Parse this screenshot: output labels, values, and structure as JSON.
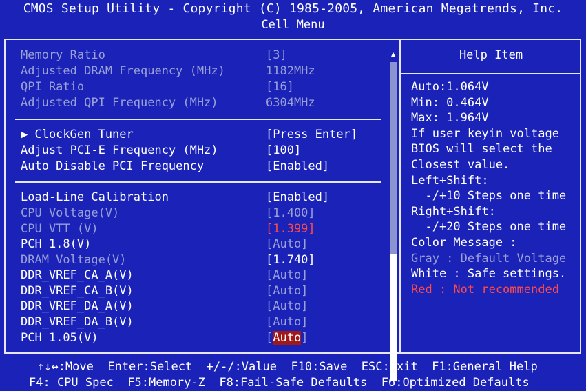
{
  "header": {
    "title": "CMOS Setup Utility - Copyright (C) 1985-2005, American Megatrends, Inc.",
    "menu": "Cell Menu"
  },
  "group1": [
    {
      "label": "Memory Ratio",
      "value": "[3]"
    },
    {
      "label": "Adjusted DRAM Frequency (MHz)",
      "value": "1182MHz"
    },
    {
      "label": "QPI Ratio",
      "value": "[16]"
    },
    {
      "label": "Adjusted QPI Frequency (MHz)",
      "value": "6304MHz"
    }
  ],
  "group2": [
    {
      "label": "▶ ClockGen Tuner",
      "value": "[Press Enter]"
    },
    {
      "label": "Adjust PCI-E Frequency (MHz)",
      "value": "[100]"
    },
    {
      "label": "Auto Disable PCI Frequency",
      "value": "[Enabled]"
    }
  ],
  "group3": [
    {
      "label": "Load-Line Calibration",
      "value": "[Enabled]"
    },
    {
      "label": "CPU Voltage(V)",
      "value": "[1.400]"
    },
    {
      "label": "CPU VTT (V)",
      "value": "[1.399]"
    },
    {
      "label": "PCH 1.8(V)",
      "value": "[Auto]"
    },
    {
      "label": "DRAM Voltage(V)",
      "value": "[1.740]"
    },
    {
      "label": "DDR_VREF_CA_A(V)",
      "value": "[Auto]"
    },
    {
      "label": "DDR_VREF_CA_B(V)",
      "value": "[Auto]"
    },
    {
      "label": "DDR_VREF_DA_A(V)",
      "value": "[Auto]"
    },
    {
      "label": "DDR_VREF_DA_B(V)",
      "value": "[Auto]"
    },
    {
      "label": "PCH 1.05(V)",
      "value": "[Auto]"
    }
  ],
  "help": {
    "title": "Help Item",
    "lines": [
      "Auto:1.064V",
      "Min: 0.464V",
      "Max: 1.964V",
      "If user keyin voltage",
      "BIOS will select the",
      "Closest value.",
      "Left+Shift:",
      "  -/+10 Steps one time",
      "Right+Shift:",
      "  -/+20 Steps one time",
      "Color Message :",
      "Gray : Default Voltage",
      "White : Safe settings.",
      "Red : Not recommended"
    ]
  },
  "footer": {
    "line1": "↑↓↔:Move  Enter:Select  +/-/:Value  F10:Save  ESC:Exit  F1:General Help",
    "line2": "F4: CPU Spec  F5:Memory-Z  F8:Fail-Safe Defaults  F6:Optimized Defaults"
  },
  "scroll": {
    "up": "▲",
    "down": "▼"
  },
  "colors": {
    "background": "#1a22b8",
    "gray": "#9aa0d8",
    "red": "#ff4a4a",
    "selected": "#a01818"
  }
}
